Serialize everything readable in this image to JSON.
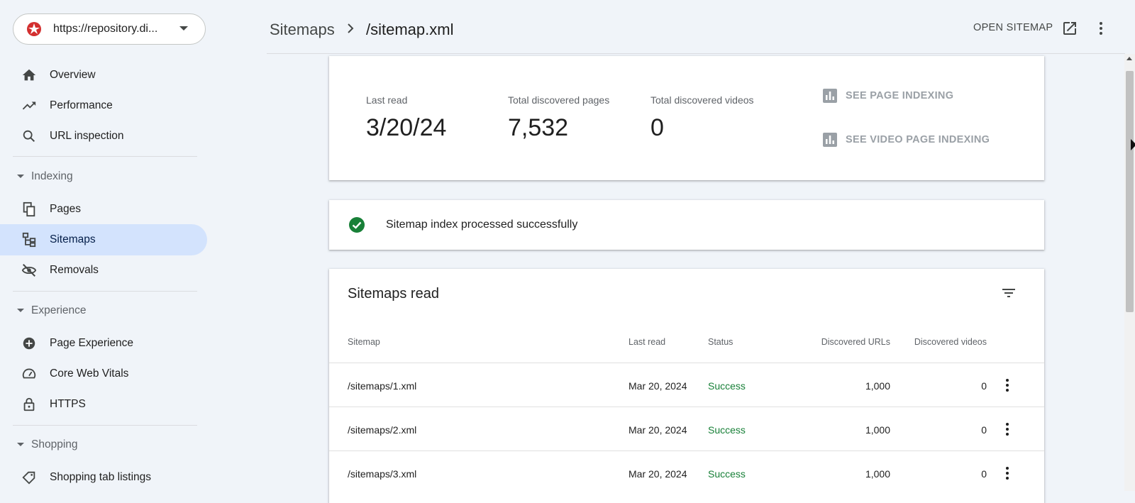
{
  "property": {
    "url": "https://repository.di..."
  },
  "sidebar": {
    "items_top": [
      {
        "label": "Overview",
        "icon": "home-icon"
      },
      {
        "label": "Performance",
        "icon": "trending-up-icon"
      },
      {
        "label": "URL inspection",
        "icon": "search-icon"
      }
    ],
    "sections": [
      {
        "label": "Indexing",
        "items": [
          {
            "label": "Pages",
            "icon": "pages-icon"
          },
          {
            "label": "Sitemaps",
            "icon": "sitemap-icon",
            "active": true
          },
          {
            "label": "Removals",
            "icon": "eye-off-icon"
          }
        ]
      },
      {
        "label": "Experience",
        "items": [
          {
            "label": "Page Experience",
            "icon": "plus-circle-icon"
          },
          {
            "label": "Core Web Vitals",
            "icon": "speedometer-icon"
          },
          {
            "label": "HTTPS",
            "icon": "lock-icon"
          }
        ]
      },
      {
        "label": "Shopping",
        "items": [
          {
            "label": "Shopping tab listings",
            "icon": "tag-icon"
          }
        ]
      }
    ]
  },
  "header": {
    "breadcrumb_root": "Sitemaps",
    "breadcrumb_current": "/sitemap.xml",
    "open_sitemap_label": "OPEN SITEMAP"
  },
  "summary": {
    "last_read_label": "Last read",
    "last_read_value": "3/20/24",
    "pages_label": "Total discovered pages",
    "pages_value": "7,532",
    "videos_label": "Total discovered videos",
    "videos_value": "0",
    "see_page_indexing": "SEE PAGE INDEXING",
    "see_video_indexing": "SEE VIDEO PAGE INDEXING"
  },
  "status": {
    "message": "Sitemap index processed successfully"
  },
  "table": {
    "title": "Sitemaps read",
    "columns": [
      "Sitemap",
      "Last read",
      "Status",
      "Discovered URLs",
      "Discovered videos"
    ],
    "rows": [
      {
        "sitemap": "/sitemaps/1.xml",
        "last_read": "Mar 20, 2024",
        "status": "Success",
        "urls": "1,000",
        "videos": "0"
      },
      {
        "sitemap": "/sitemaps/2.xml",
        "last_read": "Mar 20, 2024",
        "status": "Success",
        "urls": "1,000",
        "videos": "0"
      },
      {
        "sitemap": "/sitemaps/3.xml",
        "last_read": "Mar 20, 2024",
        "status": "Success",
        "urls": "1,000",
        "videos": "0"
      }
    ]
  },
  "colors": {
    "active_nav_bg": "#d3e3fd",
    "success_green": "#188038",
    "page_bg": "#f0f4f9"
  }
}
